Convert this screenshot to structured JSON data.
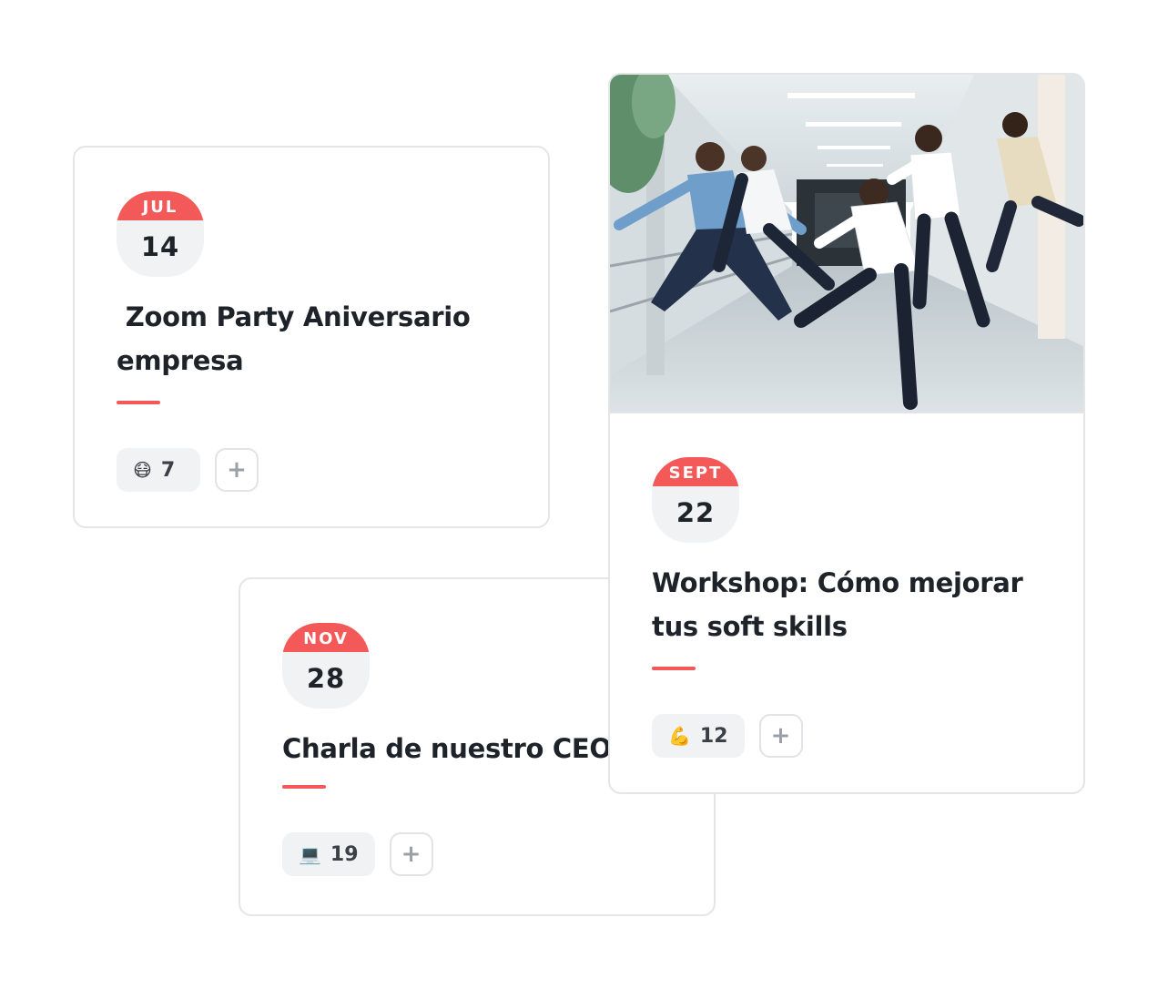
{
  "events": [
    {
      "month": "JUL",
      "day": "14",
      "title": " Zoom Party Aniversario\nempresa",
      "reaction_emoji": "😷",
      "reaction_count": "7",
      "add_label": "+"
    },
    {
      "month": "SEPT",
      "day": "22",
      "title": "Workshop: Cómo mejorar\ntus soft skills",
      "reaction_emoji": "💪",
      "reaction_count": "12",
      "add_label": "+"
    },
    {
      "month": "NOV",
      "day": "28",
      "title": "Charla de nuestro CEO",
      "reaction_emoji": "💻",
      "reaction_count": "19",
      "add_label": "+"
    }
  ],
  "colors": {
    "accent": "#f4595a",
    "badge_bg": "#f1f2f4",
    "text": "#1e2229",
    "border": "#e4e5e7"
  }
}
